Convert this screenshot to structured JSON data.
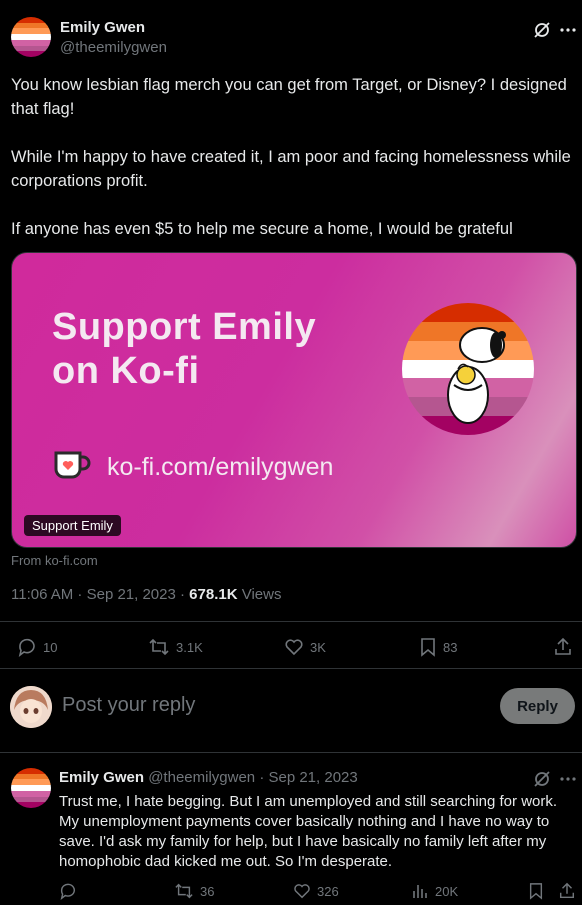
{
  "tweet": {
    "author_name": "Emily Gwen",
    "author_handle": "@theemilygwen",
    "paragraphs": [
      "You know lesbian flag merch you can get from Target, or Disney? I designed that flag!",
      "While I'm happy to have created it, I am poor and facing homelessness while corporations profit.",
      "If anyone has even $5 to help me secure a home, I would be grateful"
    ],
    "card": {
      "title_line1": "Support Emily",
      "title_line2": "on Ko-fi",
      "url": "ko-fi.com/emilygwen",
      "badge": "Support Emily",
      "source": "From ko-fi.com"
    },
    "time": "11:06 AM · Sep 21, 2023 · ",
    "views_count": "678.1K",
    "views_label": " Views",
    "actions": {
      "replies": "10",
      "reposts": "3.1K",
      "likes": "3K",
      "bookmarks": "83"
    }
  },
  "composer": {
    "placeholder": "Post your reply",
    "button": "Reply"
  },
  "reply": {
    "author_name": "Emily Gwen",
    "author_handle": "@theemilygwen",
    "date": " · Sep 21, 2023",
    "text": "Trust me, I hate begging. But I am unemployed and still searching for work. My unemployment payments cover basically nothing and I have no way to save. I'd ask my family for help, but I have basically no family left after my homophobic dad kicked me out. So I'm desperate.",
    "actions": {
      "replies": "",
      "reposts": "36",
      "likes": "326",
      "views": "20K"
    }
  },
  "colors": {
    "flag": [
      "#d62d00",
      "#ef7627",
      "#ff9a56",
      "#ffffff",
      "#d162a4",
      "#b55690",
      "#a30262"
    ],
    "background": "#000000",
    "muted": "#71767b",
    "card_pink": "#cc2d9f"
  },
  "icons": {
    "grok": "grok-icon",
    "more": "more-icon",
    "reply": "reply-icon",
    "repost": "repost-icon",
    "like": "heart-icon",
    "bookmark": "bookmark-icon",
    "share": "share-icon",
    "views": "analytics-icon",
    "kofi": "kofi-cup-icon"
  }
}
